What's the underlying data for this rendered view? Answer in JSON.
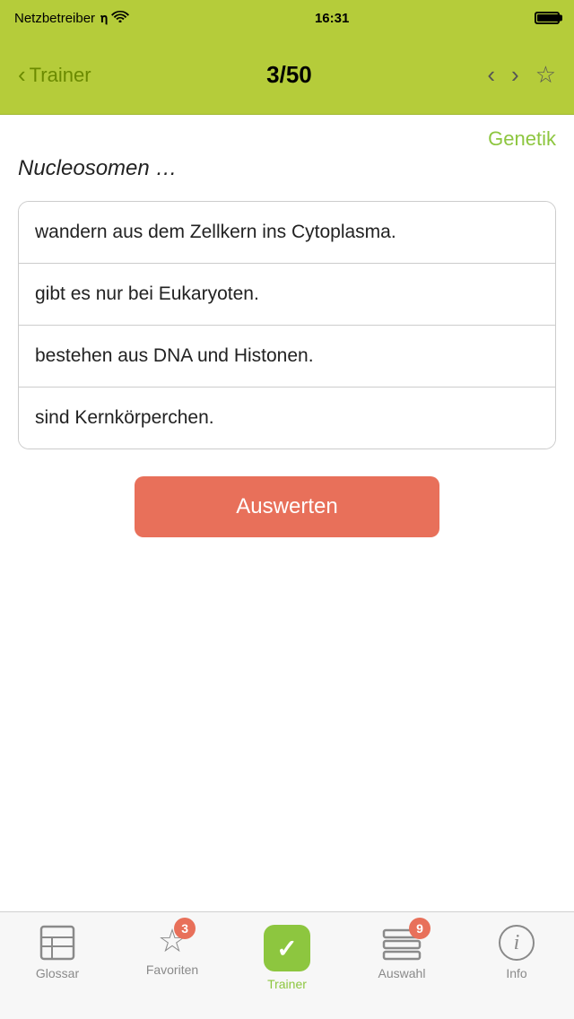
{
  "status_bar": {
    "carrier": "Netzbetreiber",
    "time": "16:31"
  },
  "nav_bar": {
    "back_label": "Trainer",
    "title": "3/50"
  },
  "category": "Genetik",
  "question": "Nucleosomen …",
  "answers": [
    {
      "id": 1,
      "text": "wandern aus dem Zellkern ins Cytoplasma."
    },
    {
      "id": 2,
      "text": "gibt es nur bei Eukaryoten."
    },
    {
      "id": 3,
      "text": "bestehen aus DNA und Histonen."
    },
    {
      "id": 4,
      "text": "sind Kernkörperchen."
    }
  ],
  "auswerten_button": "Auswerten",
  "tab_bar": {
    "items": [
      {
        "id": "glossar",
        "label": "Glossar",
        "active": false,
        "badge": null
      },
      {
        "id": "favoriten",
        "label": "Favoriten",
        "active": false,
        "badge": "3"
      },
      {
        "id": "trainer",
        "label": "Trainer",
        "active": true,
        "badge": null
      },
      {
        "id": "auswahl",
        "label": "Auswahl",
        "active": false,
        "badge": "9"
      },
      {
        "id": "info",
        "label": "Info",
        "active": false,
        "badge": null
      }
    ]
  },
  "colors": {
    "accent_green": "#b5cc3a",
    "tab_active": "#8dc63f",
    "badge_red": "#e8705a",
    "button_red": "#e8705a",
    "category_green": "#8dc63f"
  }
}
